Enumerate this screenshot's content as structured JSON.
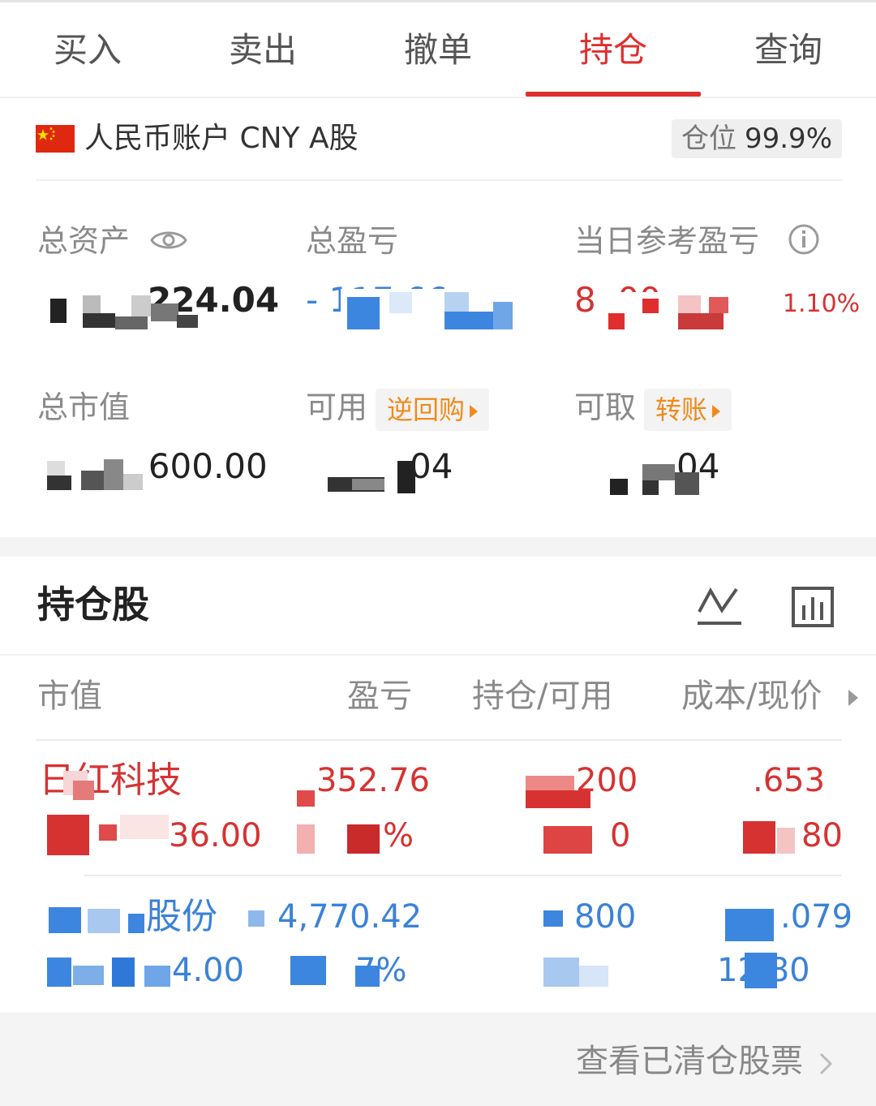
{
  "tabs": [
    {
      "label": "买入"
    },
    {
      "label": "卖出"
    },
    {
      "label": "撤单"
    },
    {
      "label": "持仓"
    },
    {
      "label": "查询"
    }
  ],
  "active_tab": "持仓",
  "account": {
    "name": "人民币账户 CNY A股",
    "position_label": "仓位",
    "position_value": "99.9%"
  },
  "summary": {
    "total_assets": {
      "label": "总资产",
      "value": "224.04"
    },
    "total_pnl": {
      "label": "总盈亏",
      "value": "- 117.66"
    },
    "daily_pnl": {
      "label": "当日参考盈亏",
      "value": "8 .00",
      "percent": "1.10%"
    },
    "market_value": {
      "label": "总市值",
      "value": "21 600.00"
    },
    "available": {
      "label": "可用",
      "tag": "逆回购",
      "value": "04"
    },
    "withdrawable": {
      "label": "可取",
      "tag": "转账",
      "value": "04"
    }
  },
  "holdings": {
    "title": "持仓股",
    "columns": [
      "市值",
      "盈亏",
      "持仓/可用",
      "成本/现价"
    ],
    "rows": [
      {
        "name": "日红科技",
        "market_value": "36.00",
        "pnl": "352.76",
        "pnl_pct": "%",
        "position": "200",
        "available": "0",
        "cost": ".653",
        "price": "80"
      },
      {
        "name": "股份",
        "market_value": "4.00",
        "pnl": "4,770.42",
        "pnl_pct": "7%",
        "position": "800",
        "available": "",
        "cost": ".079",
        "price": "12 80"
      }
    ],
    "footer_link": "查看已清仓股票"
  },
  "colors": {
    "accent": "#e02e2e",
    "profit": "#d63232",
    "loss": "#3b82d8",
    "tag": "#f08a1c"
  }
}
